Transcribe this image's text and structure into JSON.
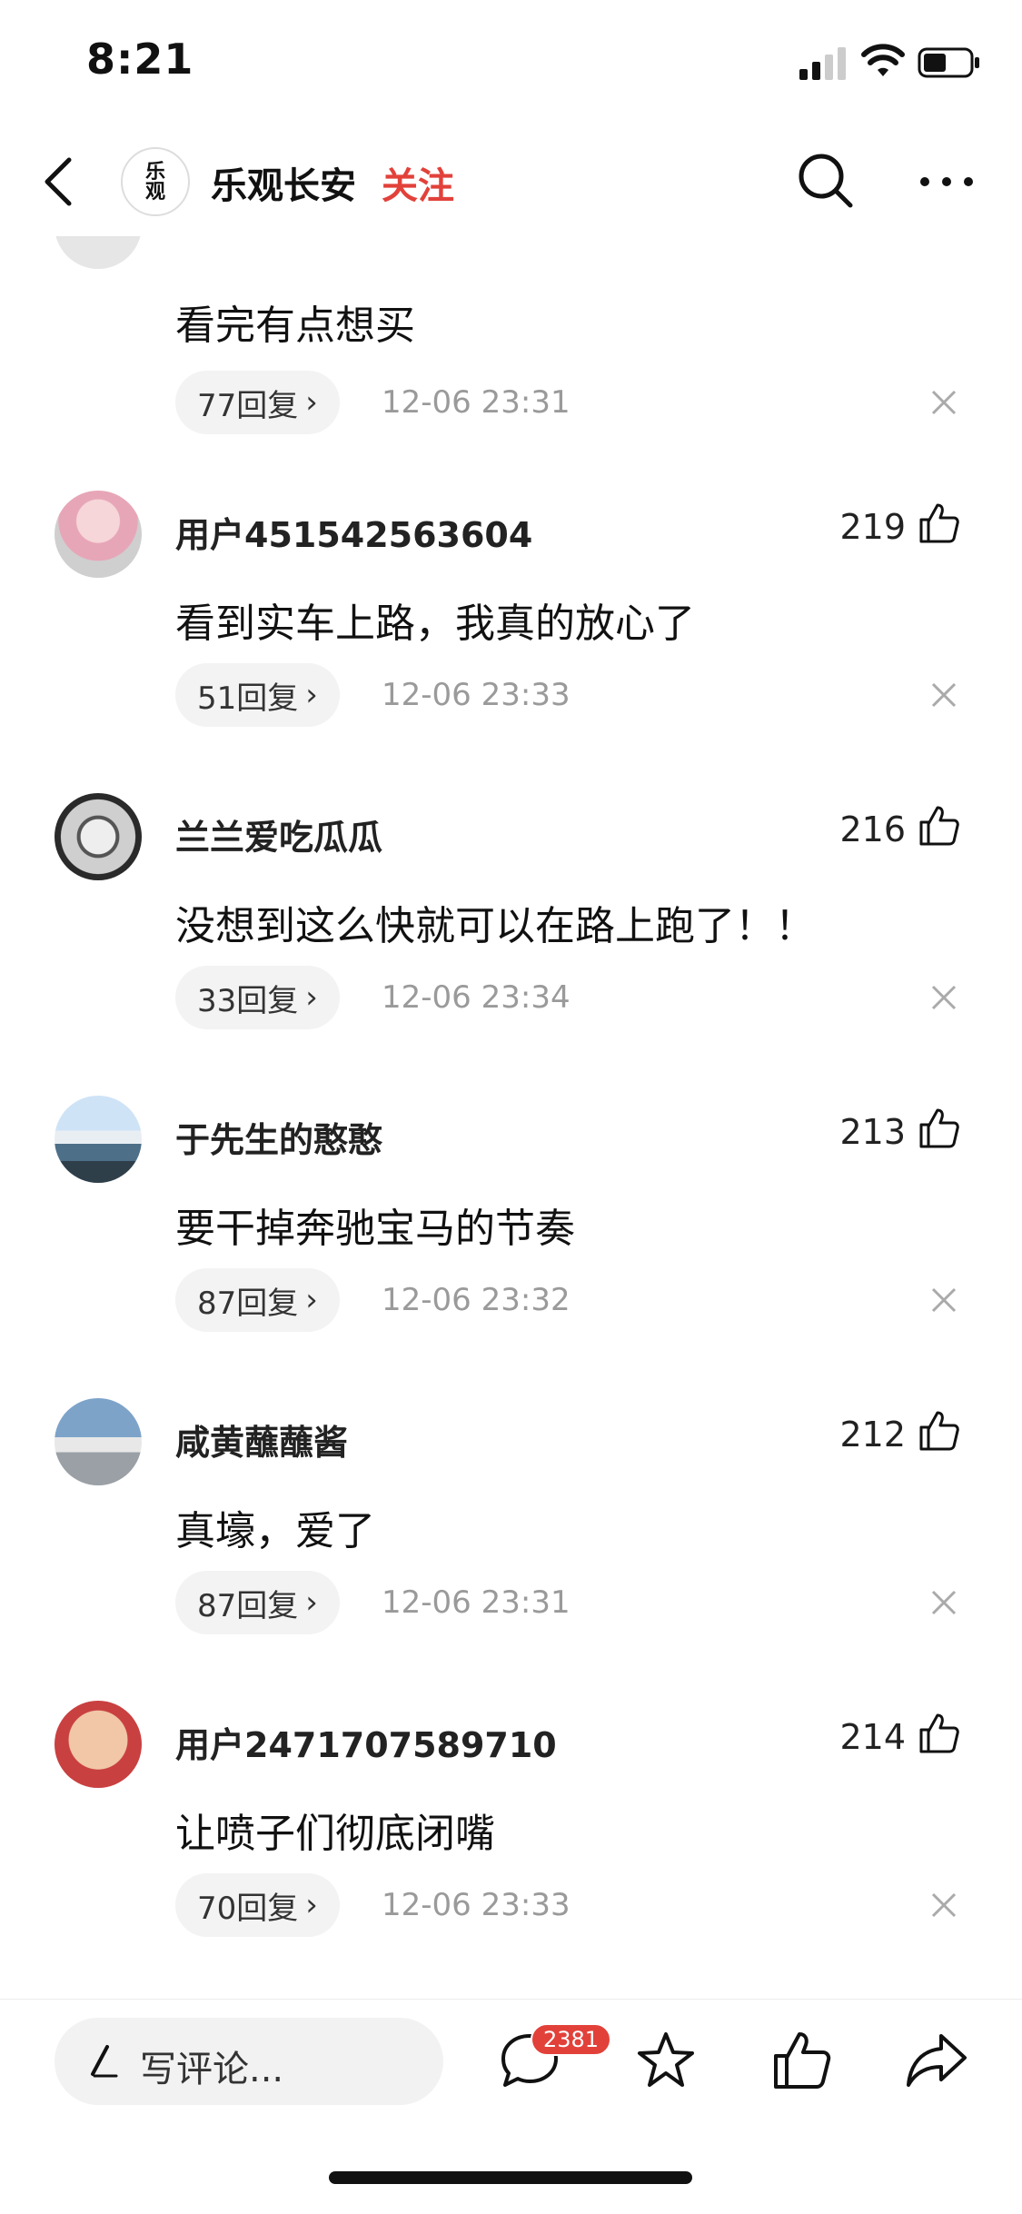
{
  "status_bar": {
    "time": "8:21"
  },
  "header": {
    "logo_text": "乐观",
    "account_name": "乐观长安",
    "follow_label": "关注"
  },
  "comments": [
    {
      "user": "",
      "likes": "",
      "text": "看完有点想买",
      "reply_count": "77回复",
      "time": "12-06 23:31"
    },
    {
      "user": "用户451542563604",
      "likes": "219",
      "text": "看到实车上路，我真的放心了",
      "reply_count": "51回复",
      "time": "12-06 23:33"
    },
    {
      "user": "兰兰爱吃瓜瓜",
      "likes": "216",
      "text": "没想到这么快就可以在路上跑了！！",
      "reply_count": "33回复",
      "time": "12-06 23:34"
    },
    {
      "user": "于先生的憨憨",
      "likes": "213",
      "text": "要干掉奔驰宝马的节奏",
      "reply_count": "87回复",
      "time": "12-06 23:32"
    },
    {
      "user": "咸黄蘸蘸酱",
      "likes": "212",
      "text": "真壕，爱了",
      "reply_count": "87回复",
      "time": "12-06 23:31"
    },
    {
      "user": "用户2471707589710",
      "likes": "214",
      "text": "让喷子们彻底闭嘴",
      "reply_count": "70回复",
      "time": "12-06 23:33"
    }
  ],
  "bottom_bar": {
    "input_placeholder": "写评论...",
    "comment_count_badge": "2381"
  },
  "icons": {
    "back": "back-icon",
    "search": "search-icon",
    "more": "more-icon",
    "like": "thumbs-up-icon",
    "close": "close-icon",
    "comment": "comment-icon",
    "star": "star-icon",
    "share": "share-icon"
  },
  "colors": {
    "accent": "#e2413a",
    "muted": "#9a9a9a",
    "pill_bg": "#f3f3f3"
  }
}
